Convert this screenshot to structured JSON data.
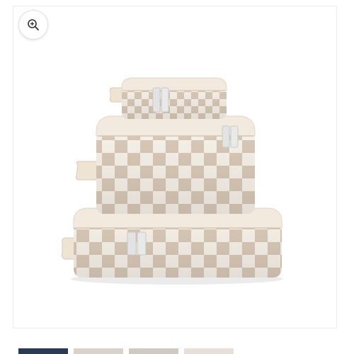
{
  "viewer": {
    "zoom_icon": "zoom-in-icon",
    "image_subject": "product-photo-checkered-packing-cubes"
  },
  "colors": {
    "check_light": "#f7f1e8",
    "check_dark": "#d8c8b7",
    "trim": "#efe3d4",
    "zipper": "#e0e0e0",
    "thumb_active": "#2b3a55"
  },
  "thumbnails": [
    {
      "icon": "thumbnail-1",
      "active": true
    },
    {
      "icon": "thumbnail-2",
      "active": false
    },
    {
      "icon": "thumbnail-3",
      "active": false
    },
    {
      "icon": "thumbnail-4",
      "active": false
    }
  ]
}
